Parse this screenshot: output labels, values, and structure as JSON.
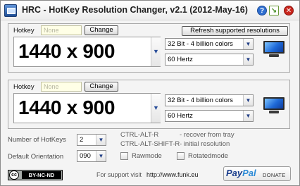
{
  "window": {
    "title": "HRC - HotKey Resolution Changer, v2.1 (2012-May-16)",
    "help_glyph": "?",
    "minimize_glyph": "↘",
    "close_glyph": "✕"
  },
  "hotkey_groups": [
    {
      "hotkey_label": "Hotkey",
      "hotkey_placeholder": "None",
      "change_label": "Change",
      "refresh_label": "Refresh supported resolutions",
      "resolution": "1440 x 900",
      "color_depth": "32 Bit - 4 billion colors",
      "frequency": "60 Hertz"
    },
    {
      "hotkey_label": "Hotkey",
      "hotkey_placeholder": "None",
      "change_label": "Change",
      "resolution": "1440 x 900",
      "color_depth": "32 Bit - 4 billion colors",
      "frequency": "60 Hertz"
    }
  ],
  "settings": {
    "num_hotkeys_label": "Number of HotKeys",
    "num_hotkeys_value": "2",
    "orientation_label": "Default Orientation",
    "orientation_value": "090",
    "hint1_keys": "CTRL-ALT-R",
    "hint1_desc": "- recover from tray",
    "hint2_keys": "CTRL-ALT-SHIFT-R",
    "hint2_desc": "- initial resolution",
    "rawmode_label": "Rawmode",
    "rotatedmode_label": "Rotatedmode"
  },
  "footer": {
    "cc_symbol": "cc",
    "cc_text": "BY-NC-ND",
    "support_text": "For support visit",
    "support_link": "http://www.funk.eu",
    "paypal_pay": "Pay",
    "paypal_pal": "Pal",
    "paypal_donate": "DONATE"
  },
  "arrow_glyph": "▼"
}
